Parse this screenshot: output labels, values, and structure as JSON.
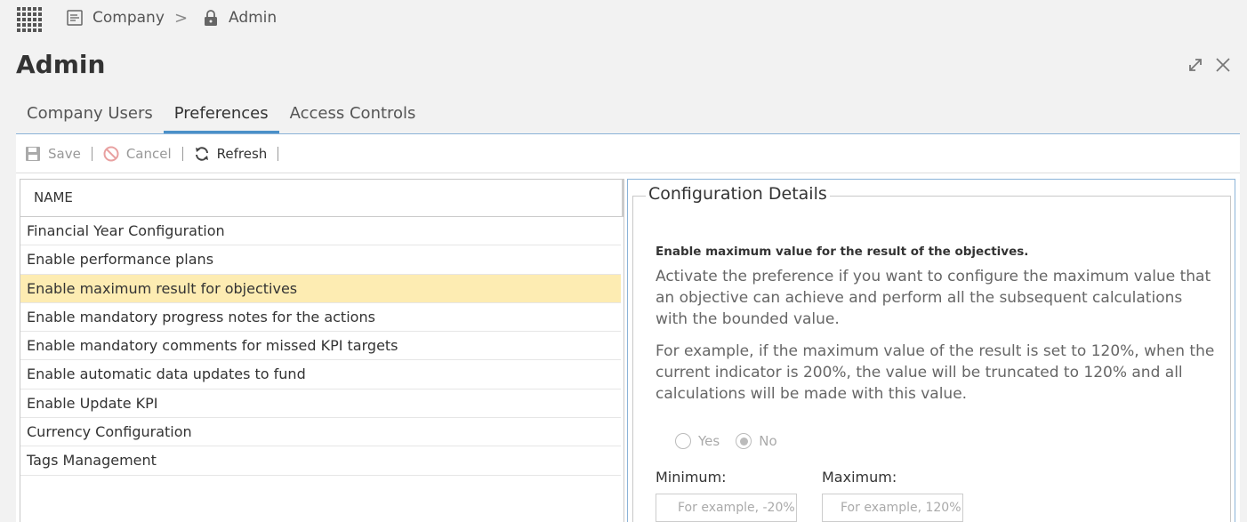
{
  "breadcrumb": {
    "items": [
      {
        "label": "Company",
        "icon": "document-icon"
      },
      {
        "label": "Admin",
        "icon": "lock-icon"
      }
    ],
    "separator": ">"
  },
  "page": {
    "title": "Admin"
  },
  "tabs": [
    {
      "label": "Company Users",
      "active": false
    },
    {
      "label": "Preferences",
      "active": true
    },
    {
      "label": "Access Controls",
      "active": false
    }
  ],
  "toolbar": {
    "save_label": "Save",
    "cancel_label": "Cancel",
    "refresh_label": "Refresh"
  },
  "list": {
    "header": "NAME",
    "items": [
      "Financial Year Configuration",
      "Enable performance plans",
      "Enable maximum result for objectives",
      "Enable mandatory progress notes for the actions",
      "Enable mandatory comments for missed KPI targets",
      "Enable automatic data updates to fund",
      "Enable Update KPI",
      "Currency Configuration",
      "Tags Management"
    ],
    "selected_index": 2
  },
  "details": {
    "legend": "Configuration Details",
    "heading": "Enable maximum value for the result of the objectives.",
    "paragraph1": "Activate the preference if you want to configure the maximum value that an objective can achieve and perform all the subsequent calculations with the bounded value.",
    "paragraph2": "For example, if the maximum value of the result is set to 120%, when the current indicator is 200%, the value will be truncated to 120% and all calculations will be made with this value.",
    "radio_yes": "Yes",
    "radio_no": "No",
    "selected_radio": "No",
    "minimum_label": "Minimum:",
    "minimum_placeholder": "For example, -20%",
    "maximum_label": "Maximum:",
    "maximum_placeholder": "For example, 120%"
  },
  "colors": {
    "accent": "#4a90c8",
    "selected_row": "#fdecb2"
  }
}
